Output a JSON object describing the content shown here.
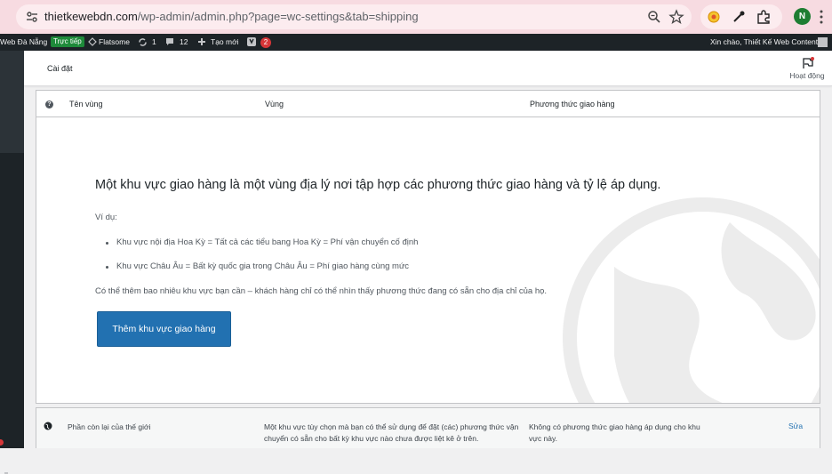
{
  "browser": {
    "url_host": "thietkewebdn.com",
    "url_path": "/wp-admin/admin.php?page=wc-settings&tab=shipping",
    "avatar_letter": "N"
  },
  "adminbar": {
    "site_name": "Web Đà Nẵng",
    "live_label": "Trực tiếp",
    "theme": "Flatsome",
    "updates_count": "1",
    "comments_count": "12",
    "new_label": "Tạo mới",
    "notifications_count": "2",
    "greeting": "Xin chào, Thiết Kế Web Content"
  },
  "wc_header": {
    "title": "Cài đặt",
    "activity_label": "Hoạt động"
  },
  "zones_table": {
    "columns": [
      "Tên vùng",
      "Vùng",
      "Phương thức giao hàng"
    ],
    "help_symbol": "?",
    "blank_state": {
      "title": "Một khu vực giao hàng là một vùng địa lý nơi tập hợp các phương thức giao hàng và tỷ lệ áp dụng.",
      "example_label": "Ví dụ:",
      "examples": [
        "Khu vực nội địa Hoa Kỳ = Tất cả các tiểu bang Hoa Kỳ = Phí vận chuyển cố định",
        "Khu vực Châu Âu = Bất kỳ quốc gia trong Châu Âu = Phí giao hàng cùng mức"
      ],
      "note": "Có thể thêm bao nhiêu khu vực bạn cần – khách hàng chỉ có thể nhìn thấy phương thức đang có sẵn cho địa chỉ của họ.",
      "add_button": "Thêm khu vực giao hàng"
    }
  },
  "rest_of_world": {
    "name": "Phần còn lại của thế giới",
    "description": "Một khu vực tùy chọn mà bạn có thể sử dụng để đặt (các) phương thức vận chuyển có sẵn cho bất kỳ khu vực nào chưa được liệt kê ở trên.",
    "methods": "Không có phương thức giao hàng áp dụng cho khu vực này.",
    "edit_label": "Sửa"
  },
  "colors": {
    "browser_bar": "#f7dbe1",
    "admin_bar": "#1d2327",
    "primary_button": "#2271b1",
    "badge_red": "#d63638",
    "live_green": "#1e8a3a"
  }
}
